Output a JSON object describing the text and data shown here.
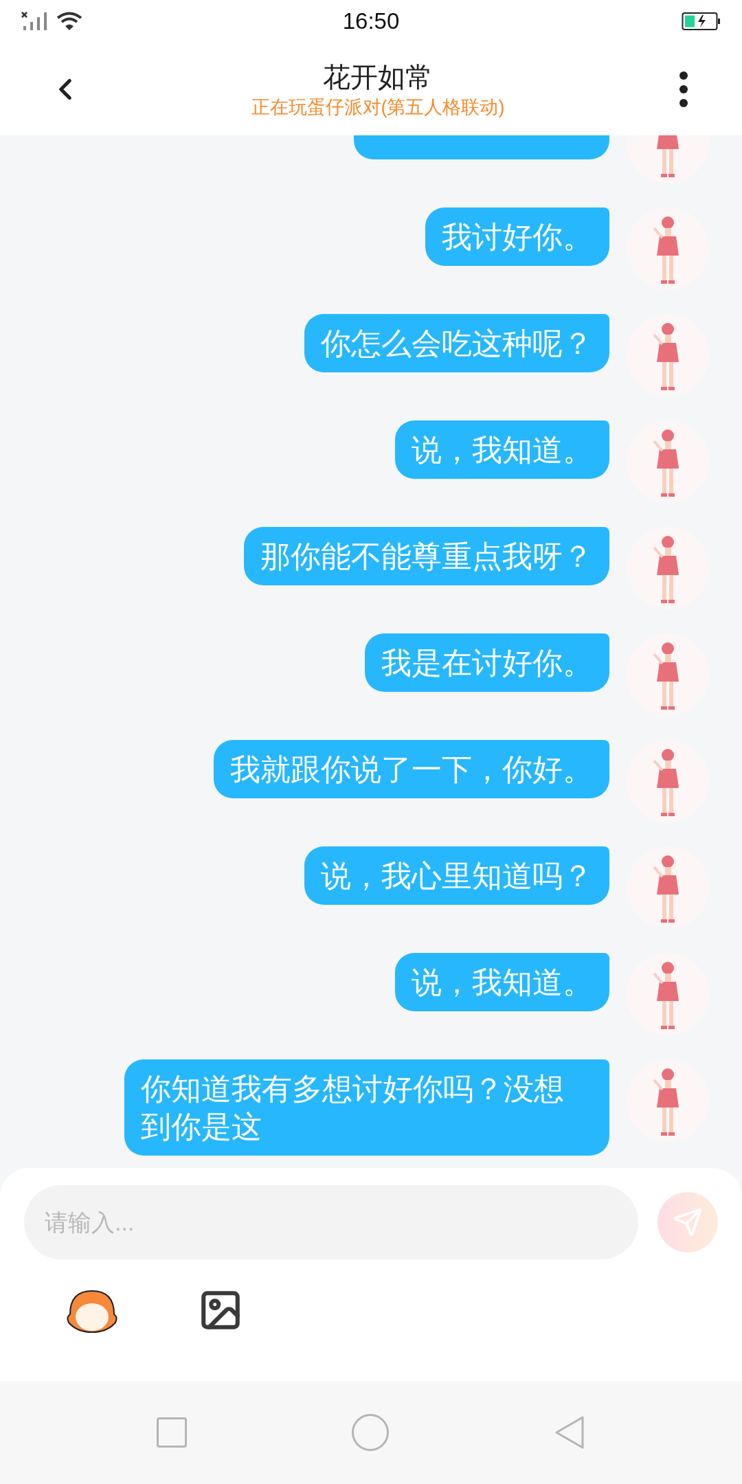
{
  "status_bar": {
    "time": "16:50"
  },
  "header": {
    "title": "花开如常",
    "subtitle": "正在玩蛋仔派对(第五人格联动)"
  },
  "messages": [
    {
      "partial": true
    },
    {
      "text": "我讨好你。"
    },
    {
      "text": "你怎么会吃这种呢？"
    },
    {
      "text": "说，我知道。"
    },
    {
      "text": "那你能不能尊重点我呀？"
    },
    {
      "text": "我是在讨好你。"
    },
    {
      "text": "我就跟你说了一下，你好。"
    },
    {
      "text": "说，我心里知道吗？"
    },
    {
      "text": "说，我知道。"
    },
    {
      "text": "你知道我有多想讨好你吗？没想到你是这"
    }
  ],
  "composer": {
    "placeholder": "请输入...",
    "send_disabled": true
  }
}
